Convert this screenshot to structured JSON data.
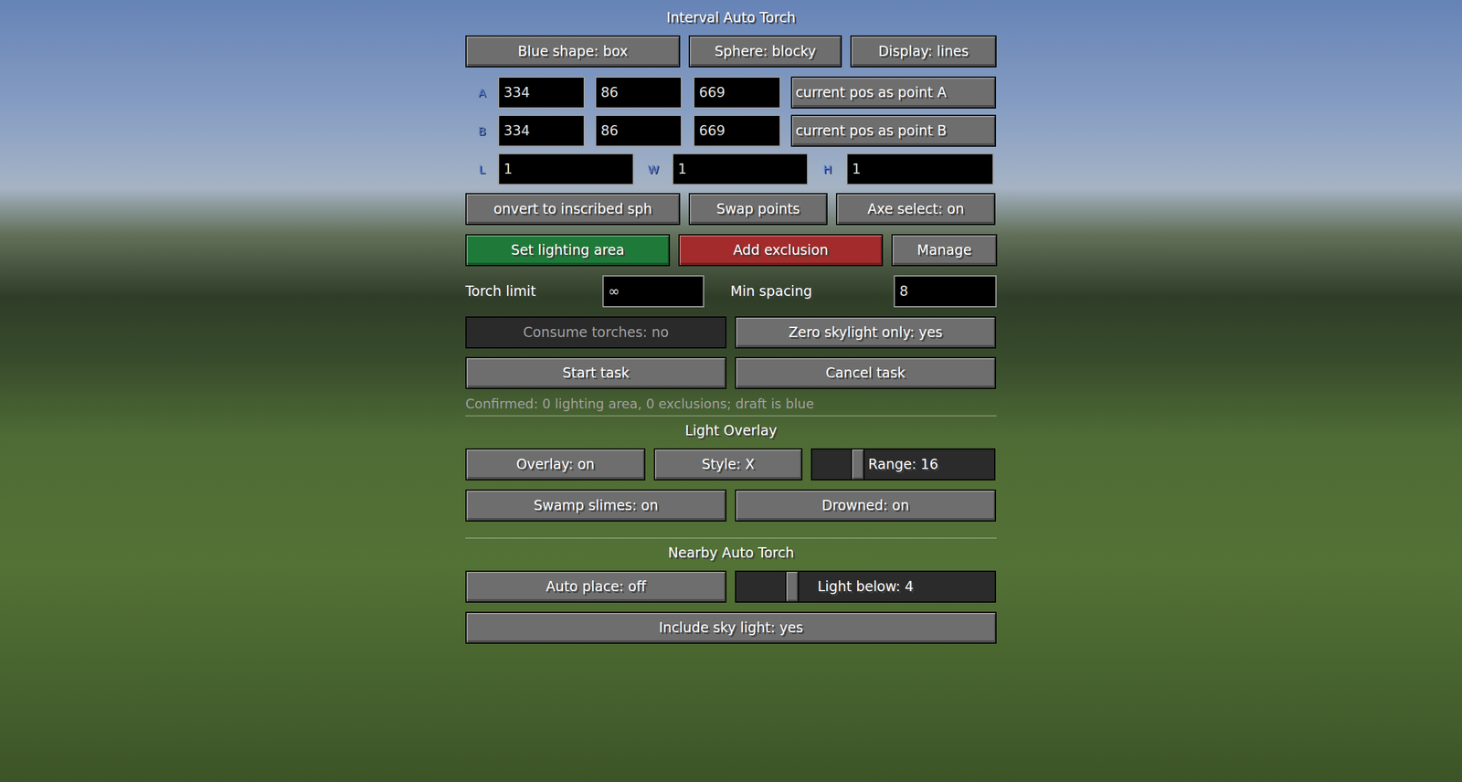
{
  "title": "Interval Auto Torch",
  "shape_buttons": [
    "Blue shape: box",
    "Sphere: blocky",
    "Display: lines"
  ],
  "points": [
    {
      "label": "A",
      "x": "334",
      "y": "86",
      "z": "669",
      "button": "current pos as point A"
    },
    {
      "label": "B",
      "x": "334",
      "y": "86",
      "z": "669",
      "button": "current pos as point B"
    }
  ],
  "dimensions": [
    {
      "label": "L",
      "value": "1"
    },
    {
      "label": "W",
      "value": "1"
    },
    {
      "label": "H",
      "value": "1"
    }
  ],
  "tool_buttons": [
    "onvert to inscribed sph",
    "Swap points",
    "Axe select: on"
  ],
  "area_buttons": [
    {
      "label": "Set lighting area",
      "color": "#1f7a3a"
    },
    {
      "label": "Add exclusion",
      "color": "#a32b2b"
    },
    {
      "label": "Manage",
      "color": "#6e6e6e"
    }
  ],
  "torch_limit": {
    "label": "Torch limit",
    "value": "∞"
  },
  "min_spacing": {
    "label": "Min spacing",
    "value": "8"
  },
  "options": [
    {
      "label": "Consume torches: no",
      "disabled": true
    },
    {
      "label": "Zero skylight only: yes",
      "disabled": false
    }
  ],
  "task_buttons": [
    "Start task",
    "Cancel task"
  ],
  "status": "Confirmed: 0 lighting area, 0 exclusions; draft is blue",
  "light_overlay": {
    "title": "Light Overlay",
    "buttons": [
      "Overlay: on",
      "Style: X"
    ],
    "range": {
      "label": "Range: 16",
      "level": 0.23
    },
    "mob_buttons": [
      "Swamp slimes: on",
      "Drowned: on"
    ]
  },
  "nearby": {
    "title": "Nearby Auto Torch",
    "auto_place": "Auto place: off",
    "light_below": {
      "label": "Light below: 4",
      "level": 0.2
    },
    "sky_light": "Include sky light: yes"
  }
}
